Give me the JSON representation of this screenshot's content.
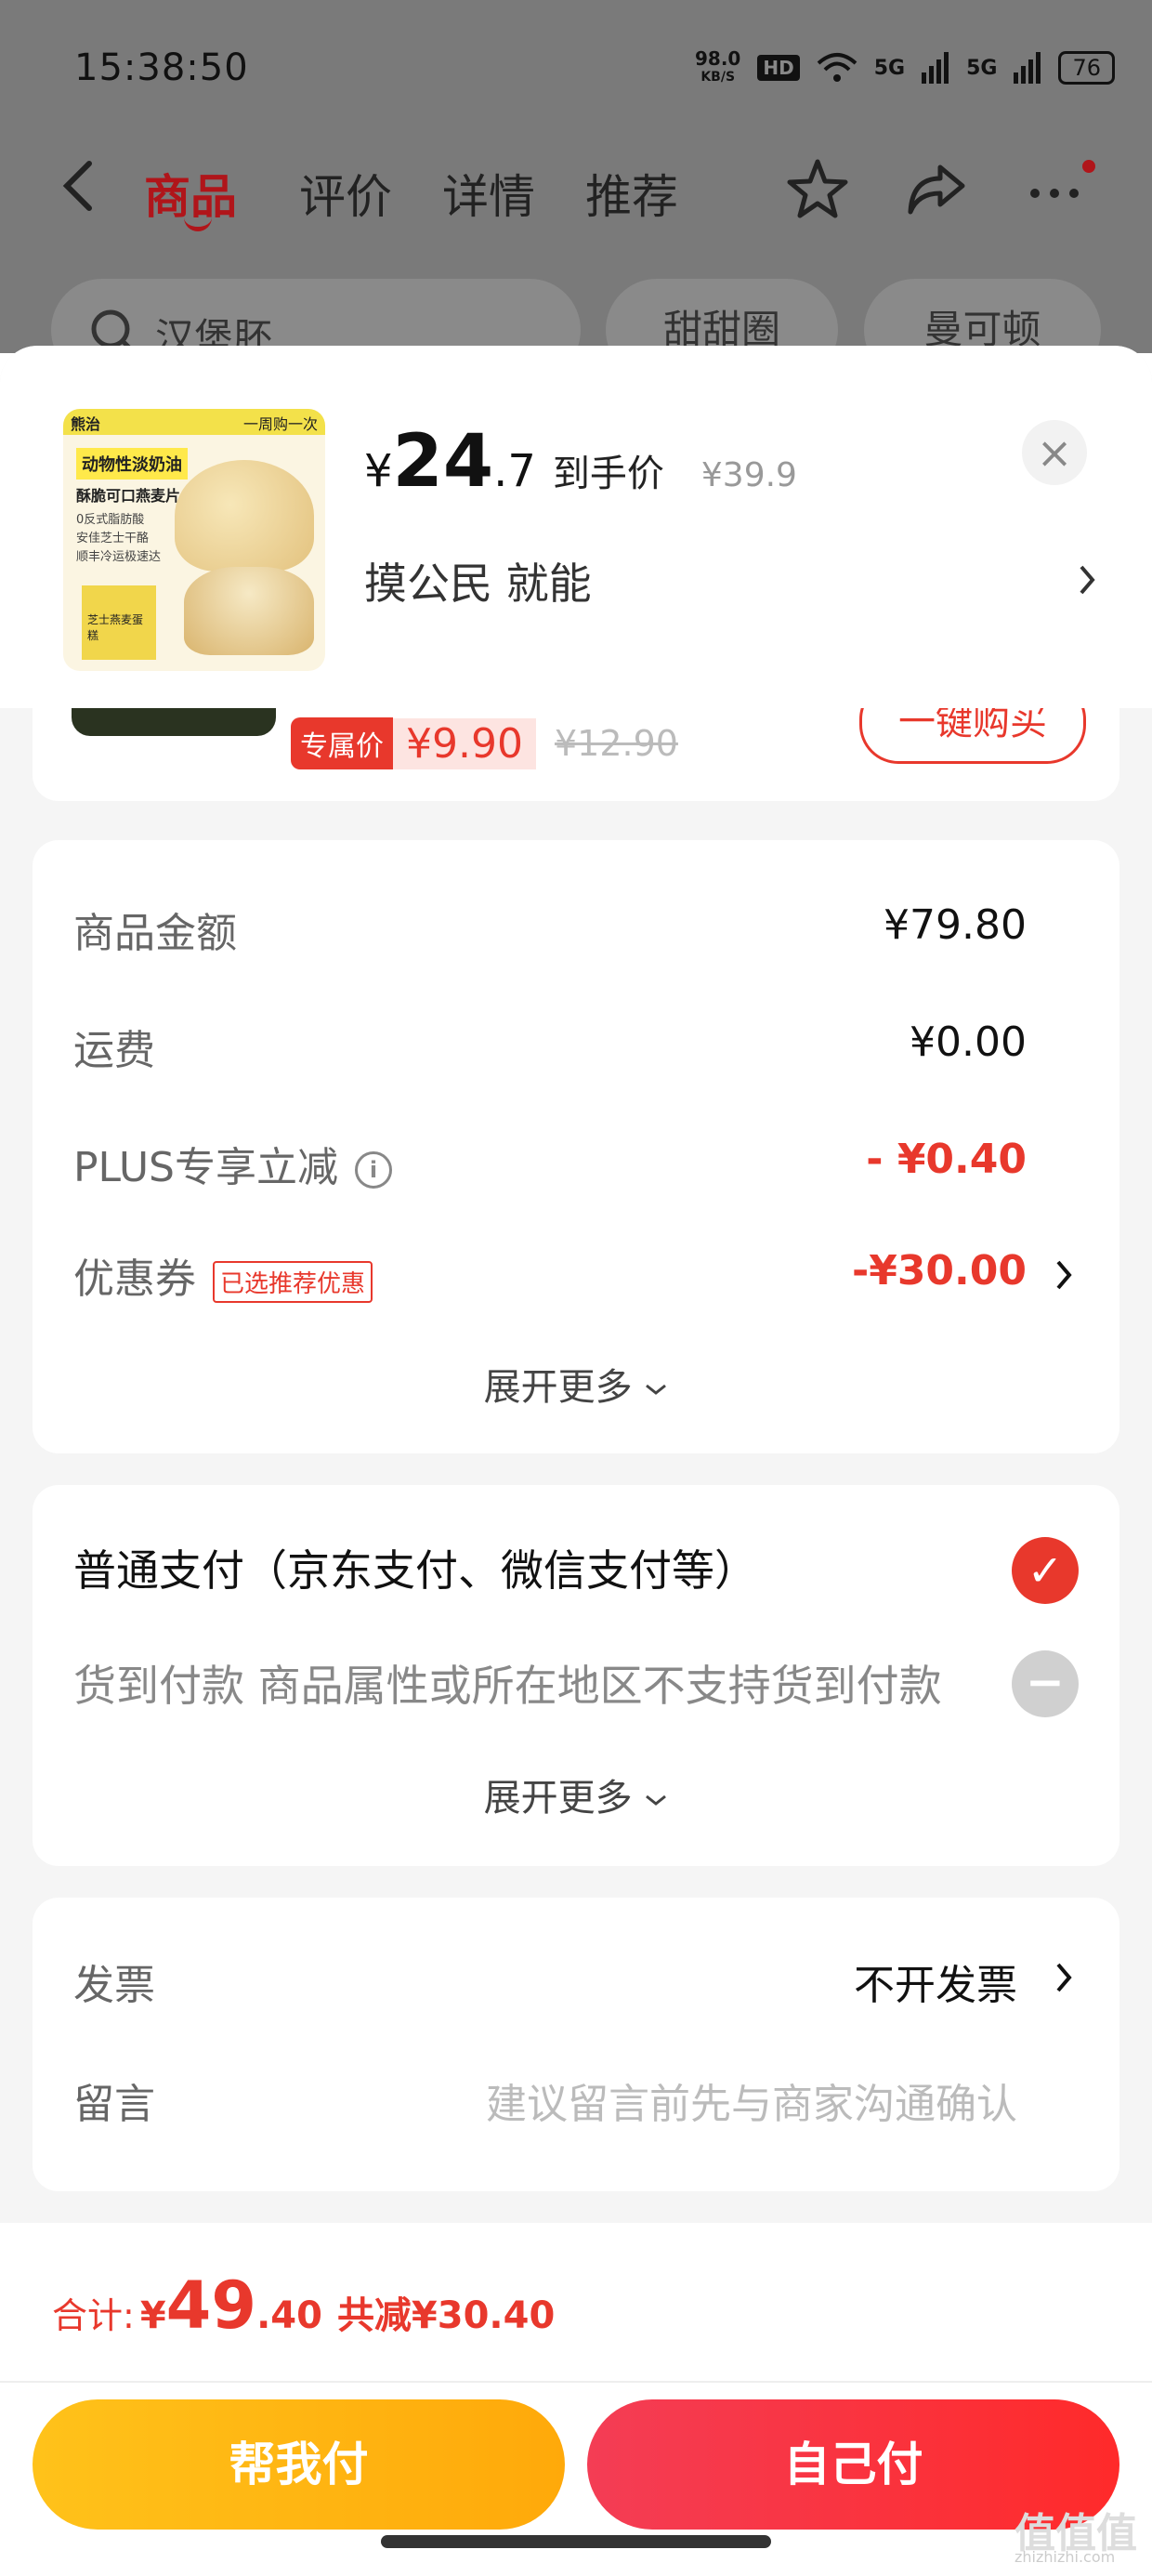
{
  "status_bar": {
    "time": "15:38:50",
    "net_speed_value": "98.0",
    "net_speed_unit": "KB/S",
    "hd": "HD",
    "signal1": "5G",
    "signal2": "5G",
    "battery": "76"
  },
  "top_nav": {
    "tabs": [
      {
        "label": "商品",
        "active": true
      },
      {
        "label": "评价"
      },
      {
        "label": "详情"
      },
      {
        "label": "推荐"
      }
    ]
  },
  "search_row": {
    "search_text": "汉堡肧",
    "pill1": "甜甜圈",
    "pill2": "曼可顿"
  },
  "product_header": {
    "thumb": {
      "brand": "熊治",
      "tagline": "一周购一次",
      "title": "动物性淡奶油",
      "subtitle": "酥脆可口燕麦片",
      "bullets": [
        "0反式脂肪酸",
        "安佳芝士干酪",
        "顺丰冷运极速达"
      ],
      "box_label": "芝士燕麦蛋糕"
    },
    "currency": "¥",
    "price_int": "24",
    "price_dec": ".7",
    "price_caption": "到手价",
    "original_price": "¥39.9",
    "spec": "摸公民  就能",
    "close": "×"
  },
  "peek_product": {
    "exclusive_label": "专属价",
    "exclusive_price": "¥9.90",
    "strike_price": "¥12.90",
    "buy_label": "一键购买"
  },
  "summary": {
    "rows": [
      {
        "label": "商品金额",
        "value": "¥79.80"
      },
      {
        "label": "运费",
        "value": "¥0.00"
      },
      {
        "label": "PLUS专享立减",
        "value": "- ¥0.40"
      },
      {
        "label": "优惠券",
        "tag": "已选推荐优惠",
        "value": "-¥30.00"
      }
    ],
    "expand": "展开更多"
  },
  "payment": {
    "normal": "普通支付（京东支付、微信支付等）",
    "cod": "货到付款 商品属性或所在地区不支持货到付款",
    "expand": "展开更多"
  },
  "invoice": {
    "invoice_label": "发票",
    "invoice_value": "不开发票",
    "message_label": "留言",
    "message_placeholder": "建议留言前先与商家沟通确认"
  },
  "footer": {
    "total_label": "合计:",
    "total_yen": "¥",
    "total_int": "49",
    "total_dec": ".40",
    "total_saved": "共减¥30.40",
    "help_pay": "帮我付",
    "self_pay": "自己付"
  },
  "watermark": {
    "text": "值值值",
    "sub": "zhizhizhi.com"
  },
  "colors": {
    "accent": "#e8382c",
    "brand_red": "#b0151a",
    "help_btn": "#ffb310",
    "self_btn": "#f43d4a"
  }
}
